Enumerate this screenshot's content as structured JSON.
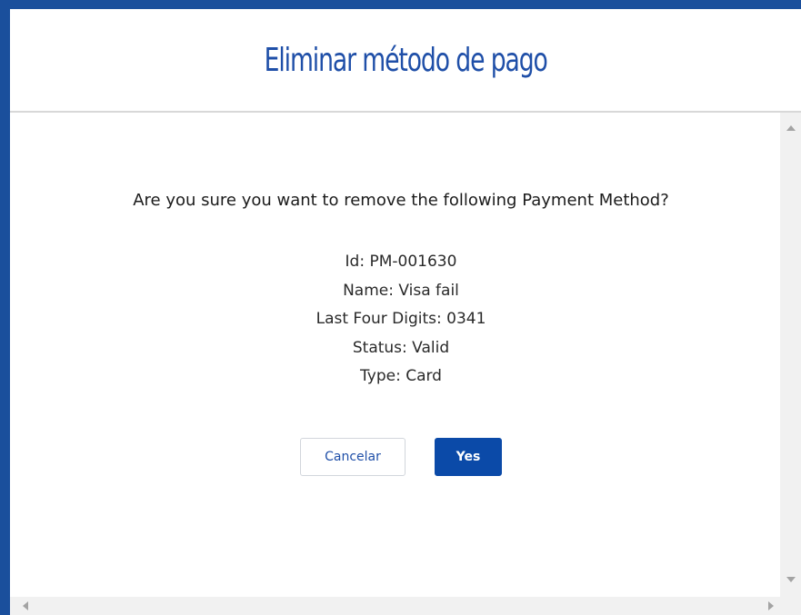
{
  "dialog": {
    "title": "Eliminar método de pago",
    "question": "Are you sure you want to remove the following Payment Method?",
    "details": [
      "Id: PM-001630",
      "Name: Visa fail",
      "Last Four Digits: 0341",
      "Status: Valid",
      "Type: Card"
    ],
    "cancel_label": "Cancelar",
    "confirm_label": "Yes"
  },
  "colors": {
    "accent": "#0b4aa8",
    "title": "#1f4fa8",
    "frame": "#1a4f9c"
  },
  "icons": {
    "scroll_up": "scroll-up-arrow-icon",
    "scroll_down": "scroll-down-arrow-icon",
    "scroll_left": "scroll-left-arrow-icon",
    "scroll_right": "scroll-right-arrow-icon"
  }
}
